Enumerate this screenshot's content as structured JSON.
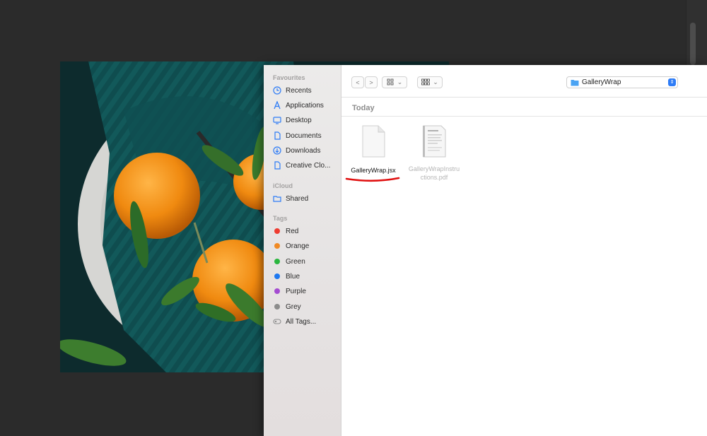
{
  "finder": {
    "location": "GalleryWrap",
    "group_header": "Today",
    "nav": {
      "back": "<",
      "forward": ">"
    },
    "view_button_chevron": "⌄",
    "group_button_chevron": "⌄",
    "path_arrows": "⇕"
  },
  "sidebar": {
    "favourites_title": "Favourites",
    "favourites": [
      {
        "label": "Recents",
        "icon": "clock-icon"
      },
      {
        "label": "Applications",
        "icon": "applications-icon"
      },
      {
        "label": "Desktop",
        "icon": "desktop-icon"
      },
      {
        "label": "Documents",
        "icon": "document-icon"
      },
      {
        "label": "Downloads",
        "icon": "download-icon"
      },
      {
        "label": "Creative Clo...",
        "icon": "file-icon"
      }
    ],
    "icloud_title": "iCloud",
    "icloud": [
      {
        "label": "Shared",
        "icon": "shared-folder-icon"
      }
    ],
    "tags_title": "Tags",
    "tags": [
      {
        "label": "Red",
        "color": "#ee3b30"
      },
      {
        "label": "Orange",
        "color": "#f08a24"
      },
      {
        "label": "Green",
        "color": "#2bb63f"
      },
      {
        "label": "Blue",
        "color": "#1f78f0"
      },
      {
        "label": "Purple",
        "color": "#a44bd1"
      },
      {
        "label": "Grey",
        "color": "#8c8c8c"
      },
      {
        "label": "All Tags...",
        "icon": "all-tags-icon"
      }
    ]
  },
  "files": [
    {
      "name": "GalleryWrap.jsx",
      "enabled": true,
      "highlighted": true
    },
    {
      "name_line1": "GalleryWrapInstru",
      "name_line2": "ctions.pdf",
      "enabled": false
    }
  ],
  "colors": {
    "accent": "#2e7cf6",
    "annotation": "#e01010",
    "sidebar_icon": "#2e7cf6"
  }
}
